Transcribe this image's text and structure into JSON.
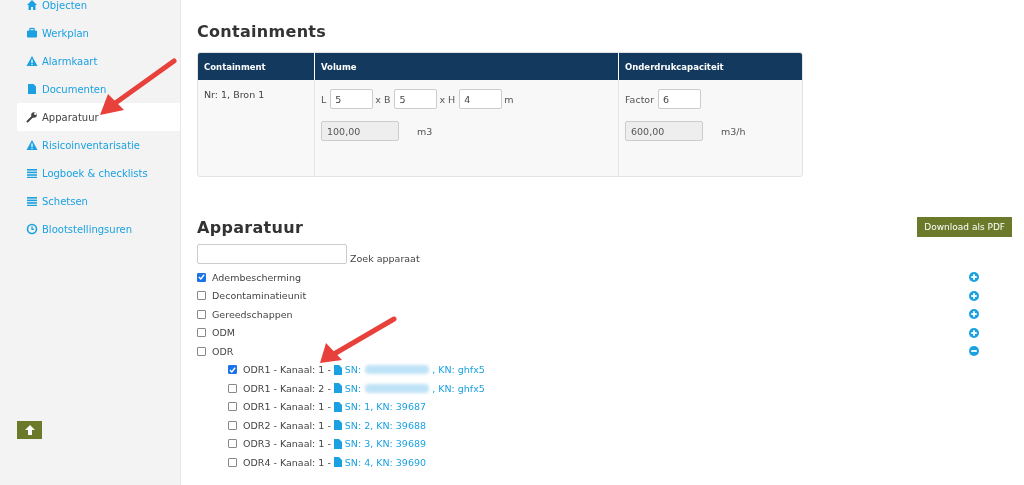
{
  "sidebar": {
    "items": [
      {
        "label": "Objecten",
        "selected": false
      },
      {
        "label": "Werkplan",
        "selected": false
      },
      {
        "label": "Alarmkaart",
        "selected": false
      },
      {
        "label": "Documenten",
        "selected": false
      },
      {
        "label": "Apparatuur",
        "selected": true
      },
      {
        "label": "Risicoinventarisatie",
        "selected": false
      },
      {
        "label": "Logboek & checklists",
        "selected": false
      },
      {
        "label": "Schetsen",
        "selected": false
      },
      {
        "label": "Blootstellingsuren",
        "selected": false
      }
    ]
  },
  "containments": {
    "title": "Containments",
    "columns": [
      "Containment",
      "Volume",
      "Onderdrukcapaciteit"
    ],
    "rows": [
      {
        "name": "Nr: 1, Bron 1",
        "l_label": "L",
        "l": "5",
        "b_label": "x B",
        "b": "5",
        "h_label": "x H",
        "h": "4",
        "dim_unit": "m",
        "volume": "100,00",
        "volume_unit": "m3",
        "factor_label": "Factor",
        "factor": "6",
        "capacity": "600,00",
        "capacity_unit": "m3/h"
      }
    ]
  },
  "apparatuur": {
    "title": "Apparatuur",
    "download_button": "Download als PDF",
    "search_label": "Zoek apparaat",
    "groups": [
      {
        "label": "Adembescherming",
        "checked": true,
        "expanded": false
      },
      {
        "label": "Decontaminatieunit",
        "checked": false,
        "expanded": false
      },
      {
        "label": "Gereedschappen",
        "checked": false,
        "expanded": false
      },
      {
        "label": "ODM",
        "checked": false,
        "expanded": false
      },
      {
        "label": "ODR",
        "checked": false,
        "expanded": true,
        "children": [
          {
            "label": "ODR1 - Kanaal: 1 -",
            "checked": true,
            "link": "SN:",
            "redacted": true,
            "link_suffix": ", KN: ghfx5"
          },
          {
            "label": "ODR1 - Kanaal: 2 -",
            "checked": false,
            "link": "SN:",
            "redacted": true,
            "link_suffix": ", KN: ghfx5"
          },
          {
            "label": "ODR1 - Kanaal: 1 -",
            "checked": false,
            "link": "SN: 1, KN: 39687",
            "redacted": false
          },
          {
            "label": "ODR2 - Kanaal: 1 -",
            "checked": false,
            "link": "SN: 2, KN: 39688",
            "redacted": false
          },
          {
            "label": "ODR3 - Kanaal: 1 -",
            "checked": false,
            "link": "SN: 3, KN: 39689",
            "redacted": false
          },
          {
            "label": "ODR4 - Kanaal: 1 -",
            "checked": false,
            "link": "SN: 4, KN: 39690",
            "redacted": false
          }
        ]
      }
    ]
  }
}
